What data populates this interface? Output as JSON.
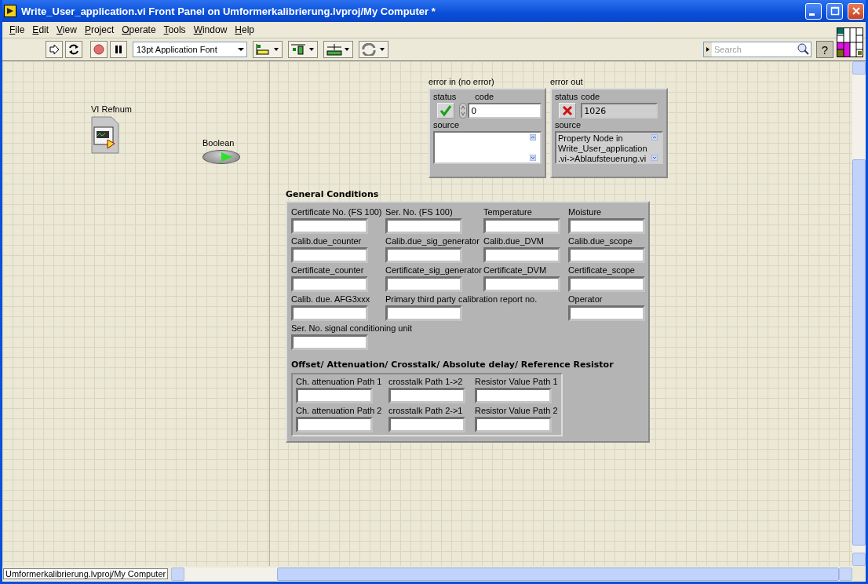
{
  "window": {
    "title": "Write_User_application.vi Front Panel on Umformerkalibrierung.lvproj/My Computer *"
  },
  "menu": [
    "File",
    "Edit",
    "View",
    "Project",
    "Operate",
    "Tools",
    "Window",
    "Help"
  ],
  "toolbar": {
    "font_selector": "13pt Application Font",
    "search": {
      "placeholder": "Search"
    },
    "help": "?"
  },
  "front_panel": {
    "vi_refnum": {
      "label": "VI Refnum"
    },
    "boolean": {
      "label": "Boolean",
      "on": true
    },
    "error_clusters": [
      {
        "label": "error in (no error)",
        "kind": "control",
        "status_label": "status",
        "error": false,
        "code_label": "code",
        "code": "0",
        "source_label": "source"
      },
      {
        "label": "error out",
        "kind": "indicator",
        "status_label": "status",
        "error": true,
        "code_label": "code",
        "code": "1026",
        "source_label": "source",
        "source": "Property Node in Write_User_application.vi->Ablaufsteuerung.vi"
      }
    ],
    "general_conditions": {
      "title": "General Conditions",
      "rows": [
        [
          "Certificate No. (FS 100)",
          "Ser. No. (FS 100)",
          "Temperature",
          "Moisture"
        ],
        [
          "Calib.due_counter",
          "Calib.due_sig_generator",
          "Calib.due_DVM",
          "Calib.due_scope"
        ],
        [
          "Certificate_counter",
          "Certificate_sig_generator",
          "Certificate_DVM",
          "Certificate_scope"
        ],
        [
          "Calib. due. AFG3xxx",
          "Primary third party calibration report no.",
          null,
          "Operator"
        ],
        [
          "Ser. No. signal conditioning unit"
        ]
      ],
      "sub_cluster": {
        "title": "Offset/ Attenuation/ Crosstalk/ Absolute delay/ Reference Resistor",
        "rows": [
          [
            "Ch. attenuation Path 1",
            "crosstalk Path 1->2",
            "Resistor Value Path 1"
          ],
          [
            "Ch. attenuation Path 2",
            "crosstalk Path 2->1",
            "Resistor Value Path 2"
          ]
        ]
      }
    }
  },
  "status_bar": {
    "context": "Umformerkalibrierung.lvproj/My Computer"
  }
}
